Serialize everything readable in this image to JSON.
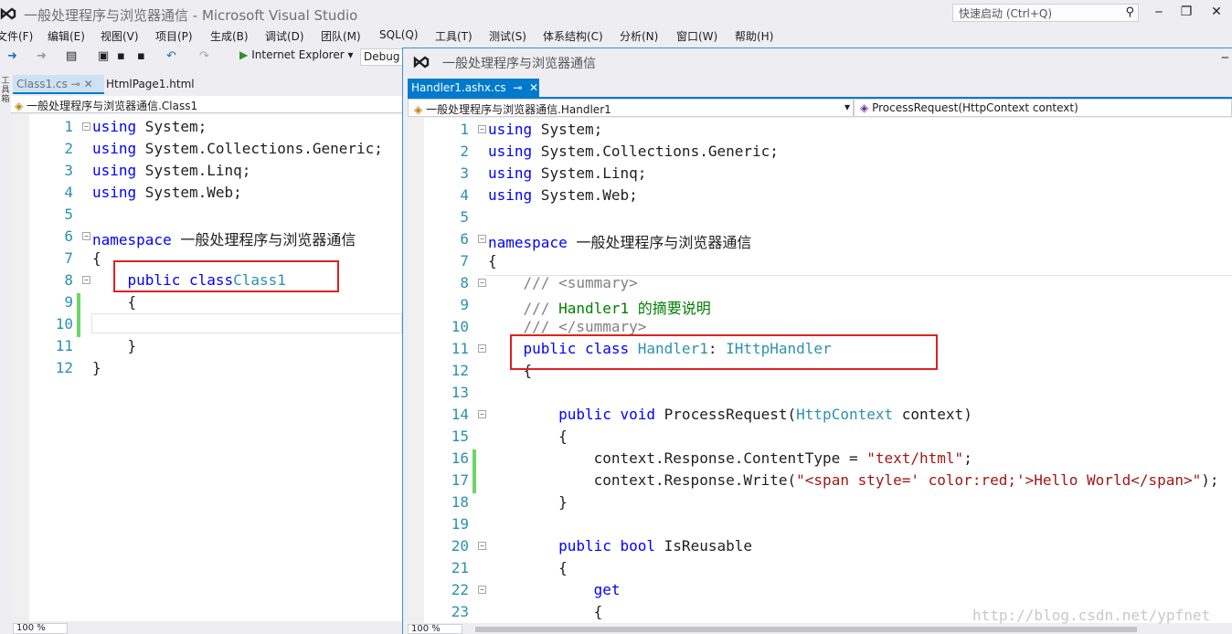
{
  "window": {
    "title": "一般处理程序与浏览器通信 - Microsoft Visual Studio",
    "quick_launch": "快速启动 (Ctrl+Q)"
  },
  "menu": [
    "文件(F)",
    "编辑(E)",
    "视图(V)",
    "项目(P)",
    "生成(B)",
    "调试(D)",
    "团队(M)",
    "SQL(Q)",
    "工具(T)",
    "测试(S)",
    "体系结构(C)",
    "分析(N)",
    "窗口(W)",
    "帮助(H)"
  ],
  "toolbar": {
    "run_target": "Internet Explorer",
    "config": "Debug"
  },
  "left_tool": "工具箱",
  "editor1": {
    "tabs": [
      "Class1.cs",
      "HtmlPage1.html"
    ],
    "nav": "一般处理程序与浏览器通信.Class1",
    "zoom": "100 %",
    "lines": [
      [
        [
          "kw",
          "using"
        ],
        [
          "",
          "System;"
        ]
      ],
      [
        [
          "kw",
          "using"
        ],
        [
          "",
          "System.Collections.Generic;"
        ]
      ],
      [
        [
          "kw",
          "using"
        ],
        [
          "",
          "System.Linq;"
        ]
      ],
      [
        [
          "kw",
          "using"
        ],
        [
          "",
          "System.Web;"
        ]
      ],
      [],
      [
        [
          "kw",
          "namespace"
        ],
        [
          "",
          "一般处理程序与浏览器通信"
        ]
      ],
      [
        [
          "",
          "{"
        ]
      ],
      [
        [
          "",
          "    "
        ],
        [
          "kw",
          "public class"
        ],
        [
          "",
          ""
        ],
        [
          "ty",
          "Class1"
        ]
      ],
      [
        [
          "",
          "    {"
        ]
      ],
      [],
      [
        [
          "",
          "    }"
        ]
      ],
      [
        [
          "",
          "}"
        ]
      ]
    ]
  },
  "editor2": {
    "window_title": "一般处理程序与浏览器通信",
    "tab": "Handler1.ashx.cs",
    "nav_left": "一般处理程序与浏览器通信.Handler1",
    "nav_right": "ProcessRequest(HttpContext context)",
    "zoom": "100 %",
    "lines": [
      [
        [
          "kw",
          "using"
        ],
        [
          "",
          "System;"
        ]
      ],
      [
        [
          "kw",
          "using"
        ],
        [
          "",
          "System.Collections.Generic;"
        ]
      ],
      [
        [
          "kw",
          "using"
        ],
        [
          "",
          "System.Linq;"
        ]
      ],
      [
        [
          "kw",
          "using"
        ],
        [
          "",
          "System.Web;"
        ]
      ],
      [],
      [
        [
          "kw",
          "namespace"
        ],
        [
          "",
          "一般处理程序与浏览器通信"
        ]
      ],
      [
        [
          "",
          "{"
        ]
      ],
      [
        [
          "",
          "    "
        ],
        [
          "cg",
          "/// <summary>"
        ]
      ],
      [
        [
          "",
          "    "
        ],
        [
          "cg",
          "///"
        ],
        [
          "cm",
          "Handler1 的摘要说明"
        ]
      ],
      [
        [
          "",
          "    "
        ],
        [
          "cg",
          "/// </summary>"
        ]
      ],
      [
        [
          "",
          "    "
        ],
        [
          "kw",
          "public class"
        ],
        [
          "ty",
          "Handler1"
        ],
        [
          "",
          ":"
        ],
        [
          "ty",
          "IHttpHandler"
        ]
      ],
      [
        [
          "",
          "    {"
        ]
      ],
      [],
      [
        [
          "",
          "        "
        ],
        [
          "kw",
          "public void"
        ],
        [
          "",
          "ProcessRequest("
        ],
        [
          "ty",
          "HttpContext"
        ],
        [
          "",
          "context)"
        ]
      ],
      [
        [
          "",
          "        {"
        ]
      ],
      [
        [
          "",
          "            context.Response.ContentType = "
        ],
        [
          "str",
          "\"text/html\""
        ],
        [
          "",
          ";"
        ]
      ],
      [
        [
          "",
          "            context.Response.Write("
        ],
        [
          "str",
          "\"<span style=' color:red;'>Hello World</span>\""
        ],
        [
          "",
          ");"
        ]
      ],
      [
        [
          "",
          "        }"
        ]
      ],
      [],
      [
        [
          "",
          "        "
        ],
        [
          "kw",
          "public bool"
        ],
        [
          "",
          "IsReusable"
        ]
      ],
      [
        [
          "",
          "        {"
        ]
      ],
      [
        [
          "",
          "            "
        ],
        [
          "kw",
          "get"
        ]
      ],
      [
        [
          "",
          "            {"
        ]
      ]
    ]
  },
  "watermark": "http://blog.csdn.net/ypfnet"
}
